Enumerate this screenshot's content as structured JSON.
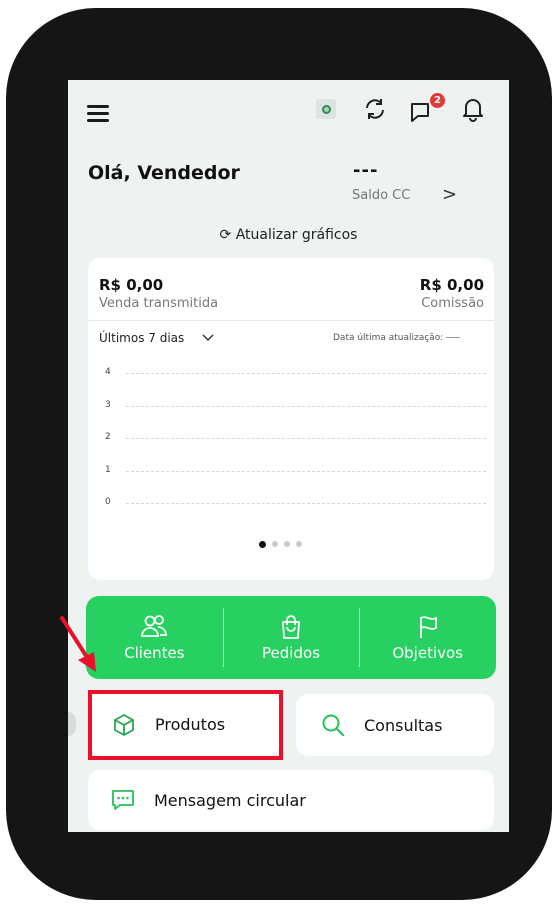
{
  "header": {
    "menu_icon": "hamburger-icon",
    "location_icon": "location-icon",
    "sync_icon": "sync-icon",
    "messages_icon": "chat-icon",
    "messages_badge": "2",
    "notifications_icon": "bell-icon"
  },
  "greeting": "Olá, Vendedor",
  "balance": {
    "value": "---",
    "label": "Saldo CC",
    "chevron": ">"
  },
  "refresh_label": "Atualizar gráficos",
  "summary": {
    "sales_value": "R$ 0,00",
    "sales_label": "Venda transmitida",
    "commission_value": "R$ 0,00",
    "commission_label": "Comissão",
    "period": "Últimos 7 dias",
    "last_update_label": "Data última atualização:"
  },
  "chart_data": {
    "type": "line",
    "y_ticks": [
      "4",
      "3",
      "2",
      "1",
      "0"
    ],
    "ylim": [
      0,
      4
    ],
    "grid": true,
    "series": []
  },
  "carousel": {
    "pages": 4,
    "active": 1
  },
  "shortcuts": [
    {
      "label": "Clientes",
      "icon": "users-icon"
    },
    {
      "label": "Pedidos",
      "icon": "shopping-bag-icon"
    },
    {
      "label": "Objetivos",
      "icon": "flag-icon"
    }
  ],
  "actions": {
    "produtos": {
      "label": "Produtos",
      "icon": "cube-icon"
    },
    "consultas": {
      "label": "Consultas",
      "icon": "search-icon"
    },
    "mensagem": {
      "label": "Mensagem circular",
      "icon": "message-icon"
    }
  },
  "colors": {
    "accent_green": "#27d060",
    "highlight_red": "#e8102a",
    "badge_red": "#e53935"
  }
}
